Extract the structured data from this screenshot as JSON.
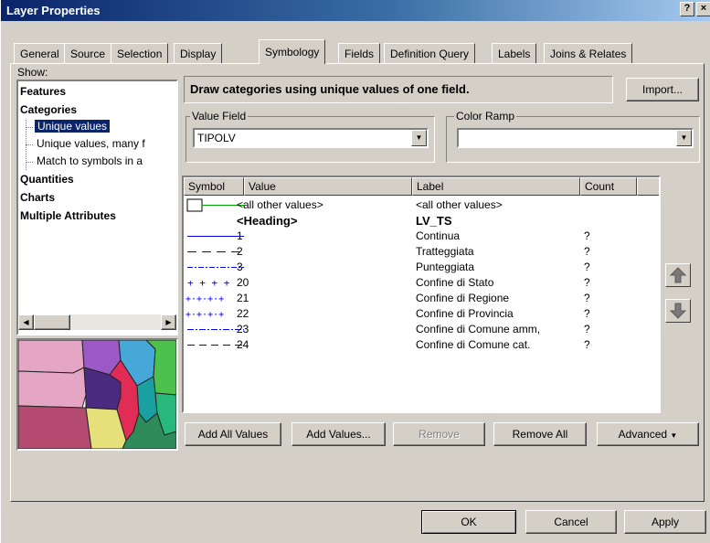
{
  "window": {
    "title": "Layer Properties",
    "help_label": "?",
    "close_label": "×"
  },
  "tabs": [
    {
      "label": "General"
    },
    {
      "label": "Source"
    },
    {
      "label": "Selection"
    },
    {
      "label": "Display"
    },
    {
      "label": "Symbology"
    },
    {
      "label": "Fields"
    },
    {
      "label": "Definition Query"
    },
    {
      "label": "Labels"
    },
    {
      "label": "Joins & Relates"
    }
  ],
  "show": {
    "label": "Show:",
    "items": [
      {
        "label": "Features"
      },
      {
        "label": "Categories"
      },
      {
        "label": "Unique values"
      },
      {
        "label": "Unique values, many f"
      },
      {
        "label": "Match to symbols in a"
      },
      {
        "label": "Quantities"
      },
      {
        "label": "Charts"
      },
      {
        "label": "Multiple Attributes"
      }
    ]
  },
  "description": "Draw categories using unique values of one field.",
  "import_button": "Import...",
  "value_field": {
    "label": "Value Field",
    "value": "TIPOLV"
  },
  "color_ramp": {
    "label": "Color Ramp",
    "value": ""
  },
  "table": {
    "headers": {
      "symbol": "Symbol",
      "value": "Value",
      "label": "Label",
      "count": "Count"
    },
    "rows": [
      {
        "symbol": "box-line",
        "value": "<all other values>",
        "label": "<all other values>",
        "count": ""
      },
      {
        "symbol": "none",
        "value": "<Heading>",
        "label": "LV_TS",
        "count": ""
      },
      {
        "symbol": "solid",
        "value": "1",
        "label": "Continua",
        "count": "?"
      },
      {
        "symbol": "dashed",
        "value": "2",
        "label": "Tratteggiata",
        "count": "?"
      },
      {
        "symbol": "dash-dot",
        "value": "3",
        "label": "Punteggiata",
        "count": "?"
      },
      {
        "symbol": "plus",
        "value": "20",
        "label": "Confine di Stato",
        "count": "?"
      },
      {
        "symbol": "plus-dot",
        "value": "21",
        "label": "Confine di Regione",
        "count": "?"
      },
      {
        "symbol": "plus-dense",
        "value": "22",
        "label": "Confine di Provincia",
        "count": "?"
      },
      {
        "symbol": "dash-dot2",
        "value": "23",
        "label": "Confine di Comune amm,",
        "count": "?"
      },
      {
        "symbol": "long-dash",
        "value": "24",
        "label": "Confine di Comune cat.",
        "count": "?"
      }
    ]
  },
  "buttons": {
    "add_all": "Add All Values",
    "add_values": "Add Values...",
    "remove": "Remove",
    "remove_all": "Remove All",
    "advanced": "Advanced",
    "ok": "OK",
    "cancel": "Cancel",
    "apply": "Apply"
  },
  "icons": {
    "move_up": "up-arrow-icon",
    "move_down": "down-arrow-icon",
    "preview": "map-preview"
  },
  "colors": {
    "title_start": "#0a246a",
    "title_end": "#a6caf0",
    "symbol_line": "#0000ff",
    "allother_line": "#00a000"
  }
}
